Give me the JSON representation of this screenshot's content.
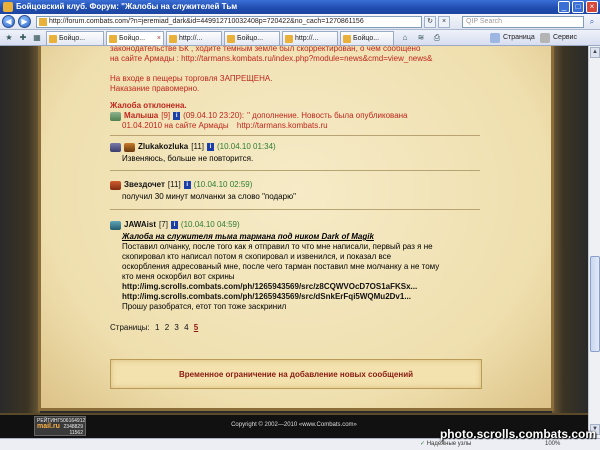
{
  "window": {
    "title": "Бойцовский клуб. Форум: \"Жалобы на служителей Тьм",
    "min": "_",
    "max": "□",
    "close": "×"
  },
  "address": {
    "url": "http://forum.combats.com/?n=jeremiad_dark&id=449912710032408p=720422&no_cach=1270861156",
    "search_placeholder": "QIP Search"
  },
  "tabs": [
    {
      "label": "Бойцо..."
    },
    {
      "label": "Бойцо..."
    },
    {
      "label": "http://..."
    },
    {
      "label": "Бойцо..."
    },
    {
      "label": "http://..."
    },
    {
      "label": "Бойцо..."
    }
  ],
  "toolbar": {
    "page_label": "Страница",
    "service_label": "Сервис"
  },
  "colors": {
    "parchment": "#efdfae",
    "accent_red": "#c0261d",
    "date_green": "#2e7d32"
  },
  "top_fragment": {
    "line1": "законодательстве БК , ходите темным землё был скорректирован, о чем сообщено",
    "line2_prefix": "на сайте Армады :",
    "line2_link": "http://tarmans.kombats.ru/index.php?module=news&cmd=view_news&"
  },
  "warning": {
    "line1": "На входе в пещеры торговля ЗАПРЕЩЕНА.",
    "line2": "Наказание правомерно."
  },
  "rejected": {
    "status": "Жалоба отклонена.",
    "moderator": "Малыша",
    "level": "[9]",
    "date": "(09.04.10 23:20):",
    "note_line1": "\" дополнение. Новость была опубликована",
    "note_line2_prefix": "01.04.2010 на сайте Армады",
    "note_link": "http://tarmans.kombats.ru"
  },
  "posts": [
    {
      "user": "Zlukakozluka",
      "level": "[11]",
      "date": "(10.04.10 01:34)",
      "text": "Извеняюсь, больше не повторится."
    },
    {
      "user": "Звездочет",
      "level": "[11]",
      "date": "(10.04.10 02:59)",
      "text": "получил 30 минут молчанки за слово \"подарю\""
    },
    {
      "user": "JAWAist",
      "level": "[7]",
      "date": "(10.04.10 04:59)",
      "subject": "Жалоба на служителя тьма тармана под ником Dark of Magik",
      "lines": [
        "Поставил олчанку, после того как я отправил то что мне написали, первый раз я не",
        "скопировал кто написал потом я скопировал и извенился, и показал все",
        "оскорбления адресованый мне, после чего тарман поставил мне молчанку а не тому",
        "кто меня оскорбил вот скрины"
      ],
      "urls": [
        "http://img.scrolls.combats.com/ph/1265943569/src/z8CQWVOcD7OS1aFKSx...",
        "http://img.scrolls.combats.com/ph/1265943569/src/dSnkErFqi5WQMu2Dv1..."
      ],
      "closing": "Прошу разобратся, етот топ тоже заскринил"
    }
  ],
  "pagination": {
    "label": "Страницы:",
    "pages": [
      "1",
      "2",
      "3",
      "4",
      "5"
    ],
    "current": "5"
  },
  "notice": "Временное ограничение на добавление новых сообщений",
  "footer": {
    "counter_label1": "РЕЙТИНГ",
    "counter_value1": "506164912",
    "counter_value2": "2348829",
    "counter_value3": "11562",
    "counter_brand": "mail.ru",
    "copyright": "Copyright © 2002—2010 «www.Combats.com»"
  },
  "status": {
    "zone": "Надежные узлы",
    "zoom": "100%"
  },
  "watermark": "photo.scrolls.combats.com"
}
